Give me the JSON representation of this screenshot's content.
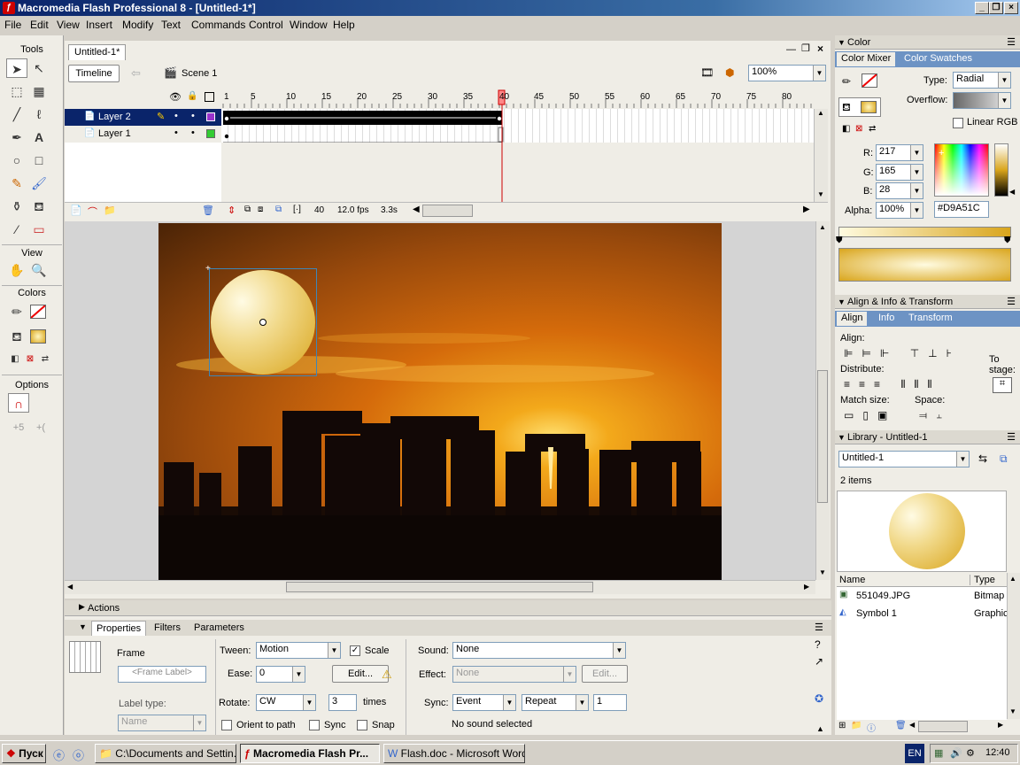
{
  "window": {
    "title": "Macromedia Flash Professional 8 - [Untitled-1*]"
  },
  "menu": [
    "File",
    "Edit",
    "View",
    "Insert",
    "Modify",
    "Text",
    "Commands",
    "Control",
    "Window",
    "Help"
  ],
  "tools": {
    "label": "Tools",
    "view_label": "View",
    "colors_label": "Colors",
    "options_label": "Options"
  },
  "document": {
    "tab": "Untitled-1*",
    "timeline_button": "Timeline",
    "scene": "Scene 1",
    "zoom": "100%"
  },
  "timeline": {
    "layers": [
      {
        "name": "Layer 2"
      },
      {
        "name": "Layer 1"
      }
    ],
    "frame_numbers": [
      "1",
      "5",
      "10",
      "15",
      "20",
      "25",
      "30",
      "35",
      "40",
      "45",
      "50",
      "55",
      "60",
      "65",
      "70",
      "75",
      "80"
    ],
    "playhead_frame": "40",
    "current_frame": "40",
    "fps": "12.0 fps",
    "elapsed": "3.3s"
  },
  "properties": {
    "tabs": [
      "Properties",
      "Filters",
      "Parameters"
    ],
    "actions": "Actions",
    "frame_label": "Frame",
    "frame_placeholder": "<Frame Label>",
    "label_type": "Label type:",
    "label_type_value": "Name",
    "tween_label": "Tween:",
    "tween_value": "Motion",
    "scale_label": "Scale",
    "ease_label": "Ease:",
    "ease_value": "0",
    "edit_button": "Edit...",
    "rotate_label": "Rotate:",
    "rotate_value": "CW",
    "times_value": "3",
    "times_label": "times",
    "orient_label": "Orient to path",
    "sync_label": "Sync",
    "snap_label": "Snap",
    "sound_label": "Sound:",
    "sound_value": "None",
    "effect_label": "Effect:",
    "effect_value": "None",
    "effect_edit": "Edit...",
    "sync2_label": "Sync:",
    "sync_value": "Event",
    "repeat_value": "Repeat",
    "repeat_count": "1",
    "no_sound": "No sound selected"
  },
  "color_panel": {
    "title": "Color",
    "tabs": [
      "Color Mixer",
      "Color Swatches"
    ],
    "type_label": "Type:",
    "type_value": "Radial",
    "overflow_label": "Overflow:",
    "linear_rgb": "Linear RGB",
    "r_label": "R:",
    "r": "217",
    "g_label": "G:",
    "g": "165",
    "b_label": "B:",
    "b": "28",
    "alpha_label": "Alpha:",
    "alpha": "100%",
    "hex": "#D9A51C"
  },
  "align_panel": {
    "title": "Align & Info & Transform",
    "tabs": [
      "Align",
      "Info",
      "Transform"
    ],
    "align": "Align:",
    "distribute": "Distribute:",
    "match_size": "Match size:",
    "space": "Space:",
    "to_stage": "To stage:"
  },
  "library": {
    "title": "Library - Untitled-1",
    "doc": "Untitled-1",
    "count": "2 items",
    "col_name": "Name",
    "col_type": "Type",
    "items": [
      {
        "name": "551049.JPG",
        "type": "Bitmap"
      },
      {
        "name": "Symbol 1",
        "type": "Graphic"
      }
    ]
  },
  "taskbar": {
    "start": "Пуск",
    "tasks": [
      "C:\\Documents and Settin...",
      "Macromedia Flash Pr...",
      "Flash.doc - Microsoft Word"
    ],
    "lang": "EN",
    "clock": "12:40"
  },
  "colors": {
    "accent": "#0a246a",
    "fill": "#D9A51C"
  }
}
